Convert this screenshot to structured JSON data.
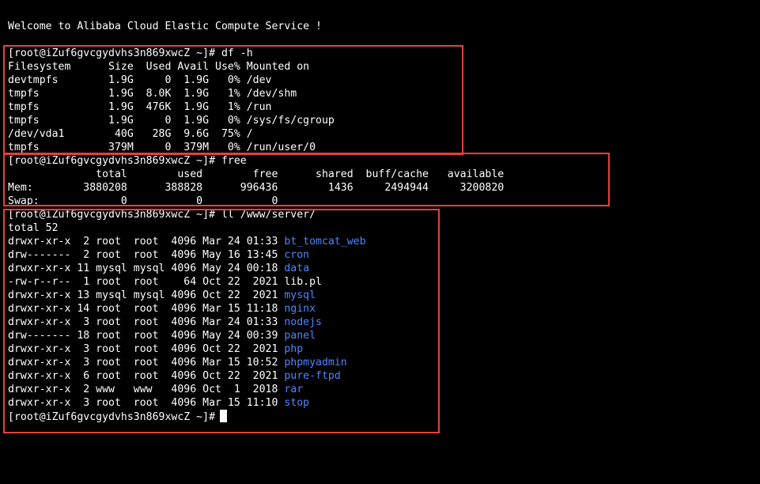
{
  "welcome": "Welcome to Alibaba Cloud Elastic Compute Service !",
  "prompt": "[root@iZuf6gvcgydvhs3n869xwcZ ~]#",
  "colors": {
    "background": "#000000",
    "text": "#ffffff",
    "directory": "#4f86ff",
    "highlight_box": "#e8403a"
  },
  "df": {
    "command": "df -h",
    "header": "Filesystem      Size  Used Avail Use% Mounted on",
    "rows": [
      "devtmpfs        1.9G     0  1.9G   0% /dev",
      "tmpfs           1.9G  8.0K  1.9G   1% /dev/shm",
      "tmpfs           1.9G  476K  1.9G   1% /run",
      "tmpfs           1.9G     0  1.9G   0% /sys/fs/cgroup",
      "/dev/vda1        40G   28G  9.6G  75% /",
      "tmpfs           379M     0  379M   0% /run/user/0"
    ]
  },
  "free": {
    "command": "free",
    "header": "              total        used        free      shared  buff/cache   available",
    "rows": [
      "Mem:        3880208      388828      996436        1436     2494944     3200820",
      "Swap:             0           0           0"
    ]
  },
  "ls": {
    "command": "ll /www/server/",
    "total": "total 52",
    "entries": [
      {
        "meta": "drwxr-xr-x  2 root  root  4096 Mar 24 01:33 ",
        "name": "bt_tomcat_web",
        "dir": true
      },
      {
        "meta": "drw-------  2 root  root  4096 May 16 13:45 ",
        "name": "cron",
        "dir": true
      },
      {
        "meta": "drwxr-xr-x 11 mysql mysql 4096 May 24 00:18 ",
        "name": "data",
        "dir": true
      },
      {
        "meta": "-rw-r--r--  1 root  root    64 Oct 22  2021 ",
        "name": "lib.pl",
        "dir": false
      },
      {
        "meta": "drwxr-xr-x 13 mysql mysql 4096 Oct 22  2021 ",
        "name": "mysql",
        "dir": true
      },
      {
        "meta": "drwxr-xr-x 14 root  root  4096 Mar 15 11:18 ",
        "name": "nginx",
        "dir": true
      },
      {
        "meta": "drwxr-xr-x  3 root  root  4096 Mar 24 01:33 ",
        "name": "nodejs",
        "dir": true
      },
      {
        "meta": "drw------- 18 root  root  4096 May 24 00:39 ",
        "name": "panel",
        "dir": true
      },
      {
        "meta": "drwxr-xr-x  3 root  root  4096 Oct 22  2021 ",
        "name": "php",
        "dir": true
      },
      {
        "meta": "drwxr-xr-x  3 root  root  4096 Mar 15 10:52 ",
        "name": "phpmyadmin",
        "dir": true
      },
      {
        "meta": "drwxr-xr-x  6 root  root  4096 Oct 22  2021 ",
        "name": "pure-ftpd",
        "dir": true
      },
      {
        "meta": "drwxr-xr-x  2 www   www   4096 Oct  1  2018 ",
        "name": "rar",
        "dir": true
      },
      {
        "meta": "drwxr-xr-x  3 root  root  4096 Mar 15 11:10 ",
        "name": "stop",
        "dir": true
      }
    ]
  }
}
